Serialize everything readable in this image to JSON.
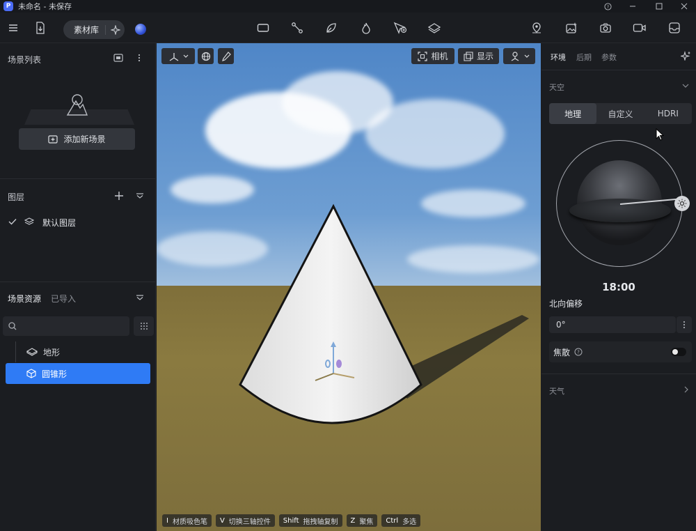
{
  "titlebar": {
    "title": "未命名 - 未保存",
    "logo": "P"
  },
  "toolbar": {
    "library_label": "素材库"
  },
  "left": {
    "scene_list_title": "场景列表",
    "add_scene_label": "添加新场景",
    "layers_title": "图层",
    "default_layer": "默认图层",
    "assets_title": "场景资源",
    "imported_tab": "已导入",
    "tree": [
      {
        "label": "地形"
      },
      {
        "label": "圆锥形"
      }
    ]
  },
  "viewport": {
    "camera_label": "相机",
    "display_label": "显示",
    "hints": [
      {
        "key": "I",
        "label": "材质吸色笔"
      },
      {
        "key": "V",
        "label": "切换三轴控件"
      },
      {
        "key": "Shift",
        "label": "拖拽轴复制"
      },
      {
        "key": "Z",
        "label": "聚焦"
      },
      {
        "key": "Ctrl",
        "label": "多选"
      }
    ]
  },
  "right": {
    "tabs": [
      "环境",
      "后期",
      "参数"
    ],
    "sky_title": "天空",
    "sky_modes": [
      "地理",
      "自定义",
      "HDRI"
    ],
    "time": "18:00",
    "north_offset_label": "北向偏移",
    "north_offset_value": "0°",
    "caustics_label": "焦散",
    "caustics_enabled": false,
    "weather_title": "天气"
  },
  "colors": {
    "accent": "#2f7bf5",
    "panel": "#1b1d21",
    "field": "#26282d"
  }
}
